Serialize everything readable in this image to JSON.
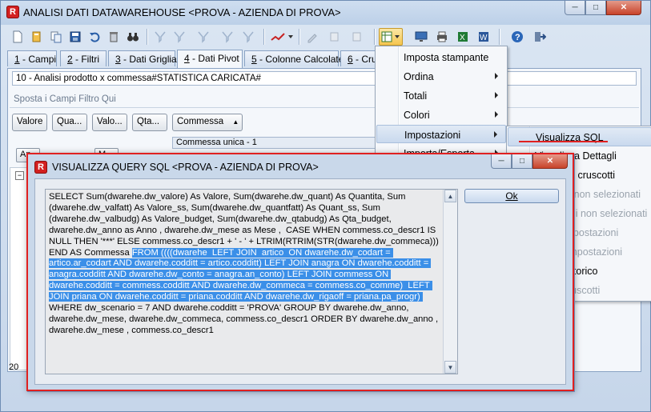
{
  "window": {
    "title": "ANALISI DATI DATAWAREHOUSE <PROVA - AZIENDA DI PROVA>"
  },
  "toolbar": {
    "icons": [
      "new-icon",
      "open-icon",
      "copy-icon",
      "save-icon",
      "undo-icon",
      "delete-icon",
      "binoculars-icon",
      "filter-icon",
      "filter-add-icon",
      "filter-remove-icon",
      "filter-clear-icon",
      "chart-icon",
      "edit-icon",
      "copy2-icon",
      "paste-icon",
      "pivot-settings-icon",
      "monitor-icon",
      "printer-icon",
      "excel-icon",
      "word-icon",
      "help-icon",
      "exit-icon"
    ]
  },
  "tabs": [
    {
      "num": "1",
      "label": " - Campi"
    },
    {
      "num": "2",
      "label": " - Filtri"
    },
    {
      "num": "3",
      "label": " - Dati Griglia"
    },
    {
      "num": "4",
      "label": " - Dati Pivot"
    },
    {
      "num": "5",
      "label": " - Colonne Calcolate"
    },
    {
      "num": "6",
      "label": " - Crus"
    }
  ],
  "pivot": {
    "analysis_name": "10 - Analisi prodotto x commessa#STATISTICA CARICATA#",
    "filter_drop_hint": "Sposta i Campi Filtro Qui",
    "data_fields": [
      "Valore",
      "Qua...",
      "Valo...",
      "Qta..."
    ],
    "column_field": "Commessa",
    "column_value": "Commessa unica - 1",
    "row_headers": [
      "An",
      "M"
    ],
    "row_year": "20"
  },
  "menu": {
    "items": [
      {
        "label": "Imposta stampante",
        "submenu": false
      },
      {
        "label": "Ordina",
        "submenu": true
      },
      {
        "label": "Totali",
        "submenu": true
      },
      {
        "label": "Colori",
        "submenu": true
      },
      {
        "label": "Impostazioni",
        "submenu": true
      },
      {
        "label": "Importa/Esporta",
        "submenu": true
      }
    ],
    "submenu": [
      {
        "label": "Visualizza SQL",
        "disabled": false
      },
      {
        "label": "Visualizza Dettagli",
        "disabled": false
      },
      {
        "label": "Gestione cruscotti",
        "disabled": false
      },
      {
        "label": "Espandi non selezionati",
        "disabled": true
      },
      {
        "label": "Comprimi non selezionati",
        "disabled": true
      },
      {
        "label": "Salva impostazioni",
        "disabled": true
      },
      {
        "label": "Carica impostazioni",
        "disabled": true
      },
      {
        "label": "Mostra storico",
        "disabled": false
      },
      {
        "label": "Salva cruscotti",
        "disabled": true
      }
    ]
  },
  "dialog": {
    "title": "VISUALIZZA QUERY SQL <PROVA - AZIENDA DI PROVA>",
    "ok_label": "Ok",
    "sql_before": "SELECT Sum(dwarehe.dw_valore) As Valore, Sum(dwarehe.dw_quant) As Quantita, Sum (dwarehe.dw_valfatt) As Valore_ss, Sum(dwarehe.dw_quantfatt) As Quant_ss, Sum (dwarehe.dw_valbudg) As Valore_budget, Sum(dwarehe.dw_qtabudg) As Qta_budget, dwarehe.dw_anno as Anno , dwarehe.dw_mese as Mese ,  CASE WHEN commess.co_descr1 IS NULL THEN '***' ELSE commess.co_descr1 + ' - ' + LTRIM(RTRIM(STR(dwarehe.dw_commeca))) END AS Commessa ",
    "sql_selected": "FROM ((((dwarehe  LEFT JOIN  artico  ON dwarehe.dw_codart = artico.ar_codart AND dwarehe.codditt = artico.codditt) LEFT JOIN anagra ON dwarehe.codditt = anagra.codditt AND dwarehe.dw_conto = anagra.an_conto) LEFT JOIN commess ON dwarehe.codditt = commess.codditt AND dwarehe.dw_commeca = commess.co_comme)  LEFT JOIN priana ON dwarehe.codditt = priana.codditt AND dwarehe.dw_rigaoff = priana.pa_progr) ",
    "sql_after": "WHERE dw_scenario = 7 AND dwarehe.codditt = 'PROVA' GROUP BY dwarehe.dw_anno, dwarehe.dw_mese, dwarehe.dw_commeca, commess.co_descr1 ORDER BY dwarehe.dw_anno , dwarehe.dw_mese , commess.co_descr1"
  }
}
